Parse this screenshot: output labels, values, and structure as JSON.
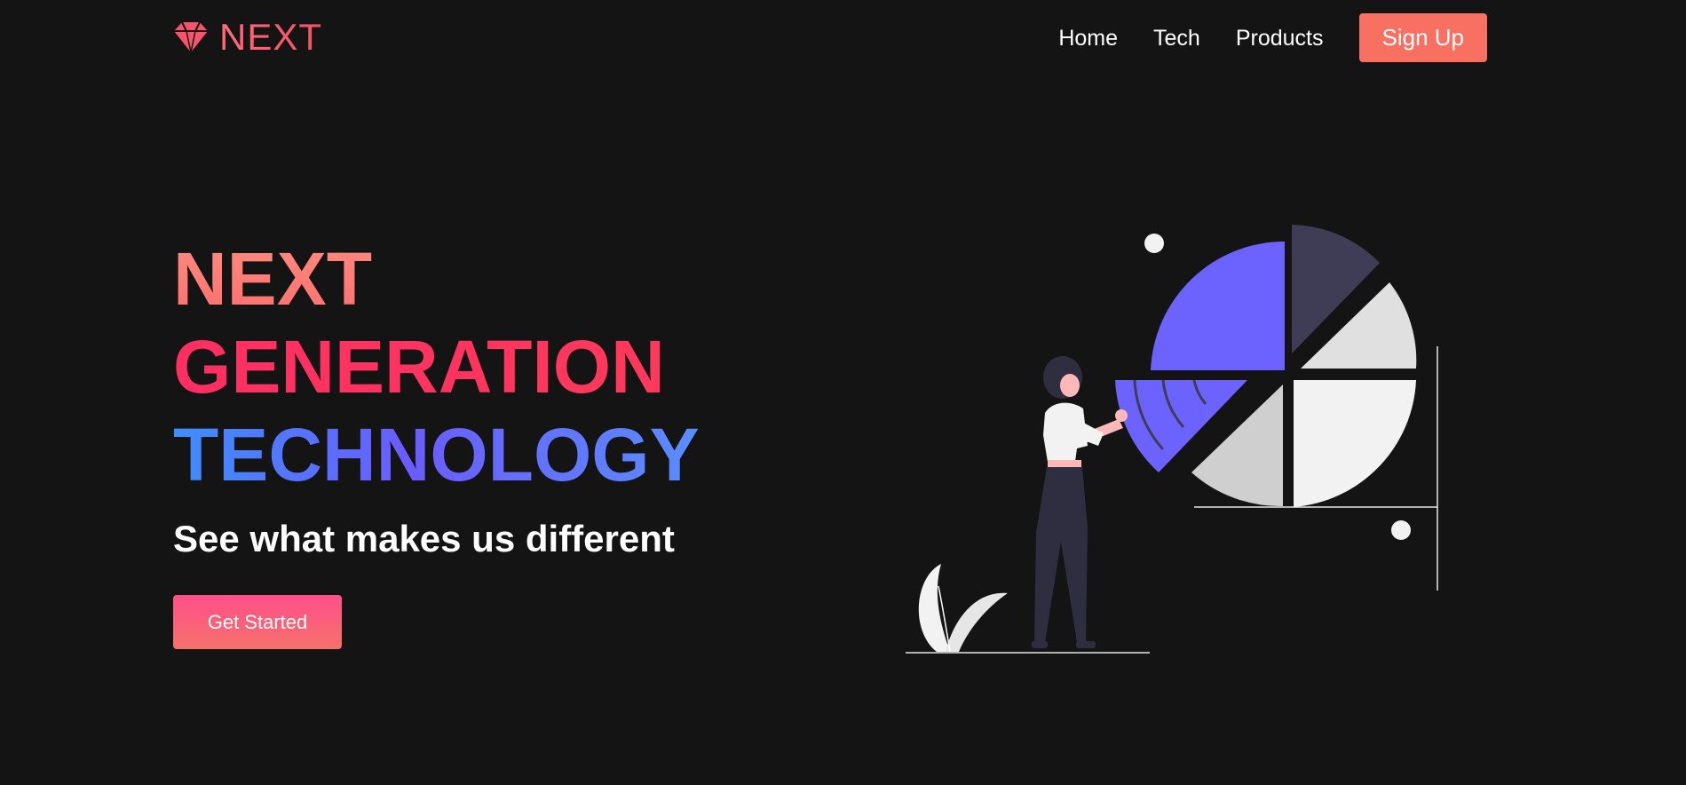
{
  "brand": {
    "name": "NEXT",
    "icon": "gem-icon",
    "color": "#f7546b"
  },
  "nav": {
    "links": [
      {
        "label": "Home"
      },
      {
        "label": "Tech"
      },
      {
        "label": "Products"
      }
    ],
    "signup_label": "Sign Up"
  },
  "hero": {
    "line1": "NEXT",
    "line2": "GENERATION",
    "line3": "TECHNOLOGY",
    "subtitle": "See what makes us different",
    "cta_label": "Get Started"
  },
  "colors": {
    "background": "#141414",
    "accent": "#f77062",
    "illustration_purple": "#6c63ff"
  },
  "illustration": {
    "name": "woman-with-pie-chart-illustration"
  }
}
